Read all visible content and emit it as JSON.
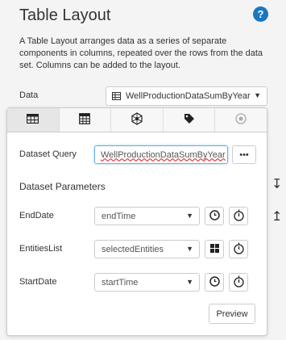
{
  "header": {
    "title": "Table Layout",
    "description": "A Table Layout arranges data as a series of separate components in columns, repeated over the rows from the data set. Columns can be added to the layout."
  },
  "data_field": {
    "label": "Data",
    "value": "WellProductionDataSumByYear"
  },
  "tabs": [
    {
      "name": "table-tab",
      "icon": "table-icon",
      "active": true
    },
    {
      "name": "calculator-tab",
      "icon": "calculator-icon",
      "active": false
    },
    {
      "name": "network-tab",
      "icon": "network-icon",
      "active": false
    },
    {
      "name": "tag-tab",
      "icon": "tag-icon",
      "active": false
    },
    {
      "name": "circle-tab",
      "icon": "circle-icon",
      "active": false
    }
  ],
  "dataset_query": {
    "label": "Dataset Query",
    "value": "WellProductionDataSumByYear",
    "more_label": "•••"
  },
  "parameters": {
    "title": "Dataset Parameters",
    "items": [
      {
        "label": "EndDate",
        "value": "endTime",
        "button1_icon": "clock-icon",
        "button2_icon": "stopwatch-icon"
      },
      {
        "label": "EntitiesList",
        "value": "selectedEntities",
        "button1_icon": "grid-icon",
        "button2_icon": "stopwatch-icon"
      },
      {
        "label": "StartDate",
        "value": "startTime",
        "button1_icon": "clock-icon",
        "button2_icon": "stopwatch-icon"
      }
    ]
  },
  "preview_label": "Preview",
  "colors": {
    "accent": "#1a78c2",
    "focus_border": "#66afe9"
  }
}
